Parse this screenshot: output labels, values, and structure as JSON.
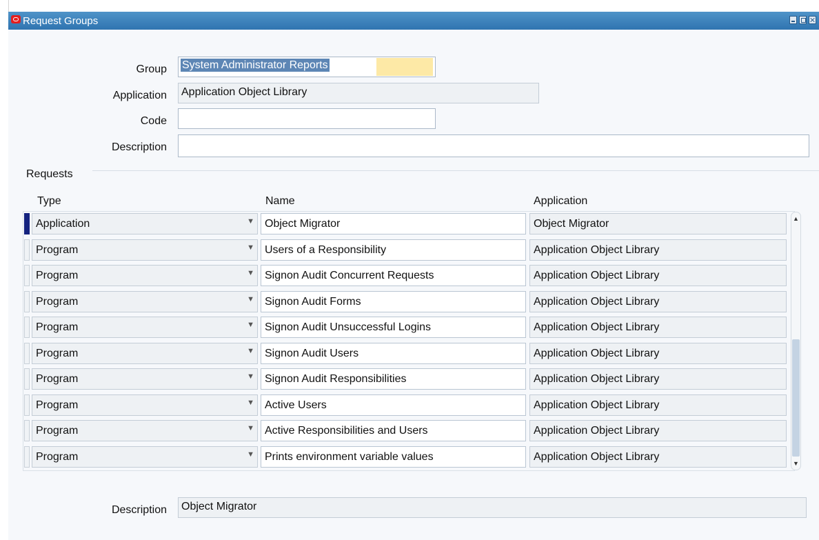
{
  "window": {
    "title": "Request Groups"
  },
  "header_form": {
    "group_label": "Group",
    "group_value": "System Administrator Reports",
    "application_label": "Application",
    "application_value": "Application Object Library",
    "code_label": "Code",
    "code_value": "",
    "description_label": "Description",
    "description_value": ""
  },
  "requests": {
    "section_label": "Requests",
    "columns": {
      "type": "Type",
      "name": "Name",
      "application": "Application"
    },
    "rows": [
      {
        "type": "Application",
        "name": "Object Migrator",
        "application": "Object Migrator"
      },
      {
        "type": "Program",
        "name": "Users of a Responsibility",
        "application": "Application Object Library"
      },
      {
        "type": "Program",
        "name": "Signon Audit Concurrent Requests",
        "application": "Application Object Library"
      },
      {
        "type": "Program",
        "name": "Signon Audit Forms",
        "application": "Application Object Library"
      },
      {
        "type": "Program",
        "name": "Signon Audit Unsuccessful Logins",
        "application": "Application Object Library"
      },
      {
        "type": "Program",
        "name": "Signon Audit Users",
        "application": "Application Object Library"
      },
      {
        "type": "Program",
        "name": "Signon Audit Responsibilities",
        "application": "Application Object Library"
      },
      {
        "type": "Program",
        "name": "Active Users",
        "application": "Application Object Library"
      },
      {
        "type": "Program",
        "name": "Active Responsibilities and Users",
        "application": "Application Object Library"
      },
      {
        "type": "Program",
        "name": "Prints environment variable values",
        "application": "Application Object Library"
      }
    ]
  },
  "footer": {
    "description_label": "Description",
    "description_value": "Object Migrator"
  },
  "colors": {
    "titlebar": "#2f74b0",
    "selection": "#5d86b5",
    "current_record": "#15237f",
    "required_field": "#fde9a6"
  }
}
